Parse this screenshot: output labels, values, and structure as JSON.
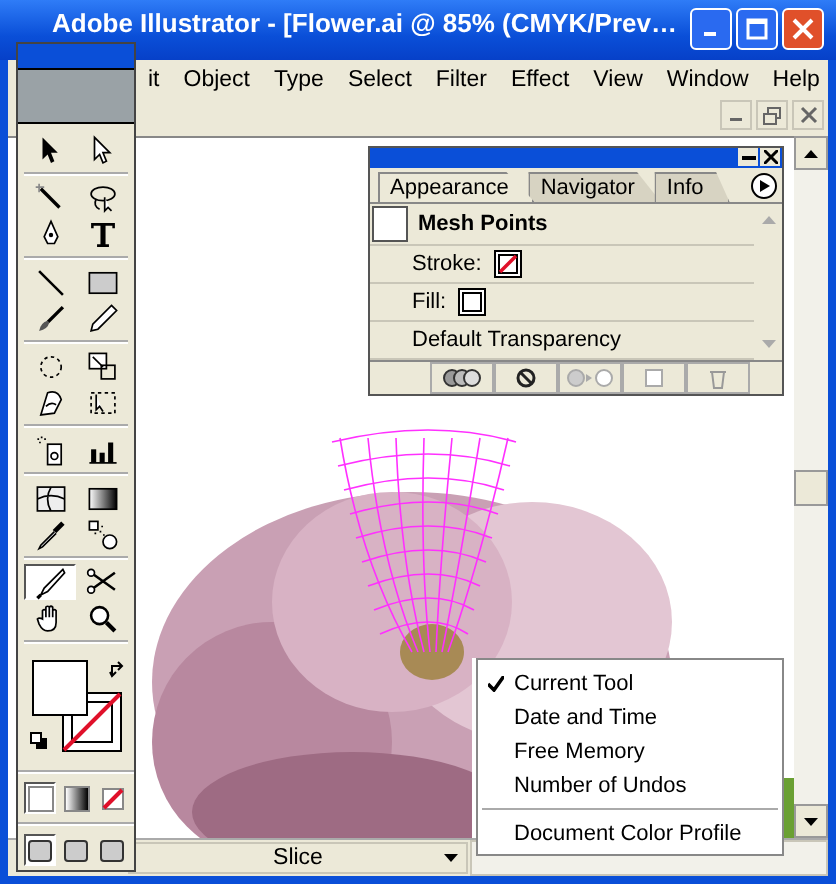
{
  "window": {
    "title": "Adobe Illustrator - [Flower.ai @ 85% (CMYK/Prev…"
  },
  "menu_bar": [
    "it",
    "Object",
    "Type",
    "Select",
    "Filter",
    "Effect",
    "View",
    "Window",
    "Help"
  ],
  "toolbox": {
    "tools": [
      {
        "kind": "selection",
        "selected": false
      },
      {
        "kind": "direct-selection",
        "selected": false
      },
      {
        "kind": "magic-wand",
        "selected": false
      },
      {
        "kind": "lasso",
        "selected": false
      },
      {
        "kind": "pen",
        "selected": false
      },
      {
        "kind": "type",
        "selected": false
      },
      {
        "kind": "line",
        "selected": false
      },
      {
        "kind": "rectangle",
        "selected": false
      },
      {
        "kind": "paintbrush",
        "selected": false
      },
      {
        "kind": "pencil",
        "selected": false
      },
      {
        "kind": "rotate",
        "selected": false
      },
      {
        "kind": "scale",
        "selected": false
      },
      {
        "kind": "warp",
        "selected": false
      },
      {
        "kind": "free-transform",
        "selected": false
      },
      {
        "kind": "sprayer",
        "selected": false
      },
      {
        "kind": "graph",
        "selected": false
      },
      {
        "kind": "mesh",
        "selected": false
      },
      {
        "kind": "gradient",
        "selected": false
      },
      {
        "kind": "eyedropper",
        "selected": false
      },
      {
        "kind": "blend",
        "selected": false
      },
      {
        "kind": "knife",
        "selected": true
      },
      {
        "kind": "scissors",
        "selected": false
      },
      {
        "kind": "hand",
        "selected": false
      },
      {
        "kind": "zoom",
        "selected": false
      }
    ],
    "color_modes": [
      {
        "kind": "color",
        "selected": true
      },
      {
        "kind": "gradient",
        "selected": false
      },
      {
        "kind": "none",
        "selected": false
      }
    ],
    "screen_modes": [
      {
        "selected": true
      },
      {
        "selected": false
      },
      {
        "selected": false
      }
    ]
  },
  "appearance_panel": {
    "tabs": [
      {
        "label": "Appearance",
        "selected": true
      },
      {
        "label": "Navigator",
        "selected": false
      },
      {
        "label": "Info",
        "selected": false
      }
    ],
    "header": "Mesh Points",
    "rows": [
      {
        "label": "Stroke:",
        "kind": "stroke"
      },
      {
        "label": "Fill:",
        "kind": "fill"
      },
      {
        "label": "Default Transparency",
        "kind": "text"
      }
    ]
  },
  "status_bar": {
    "tool": "Slice"
  },
  "status_menu": {
    "items": [
      {
        "label": "Current Tool",
        "checked": true,
        "separator_before": false
      },
      {
        "label": "Date and Time",
        "checked": false,
        "separator_before": false
      },
      {
        "label": "Free Memory",
        "checked": false,
        "separator_before": false
      },
      {
        "label": "Number of Undos",
        "checked": false,
        "separator_before": false
      },
      {
        "label": "Document Color Profile",
        "checked": false,
        "separator_before": true
      }
    ]
  }
}
